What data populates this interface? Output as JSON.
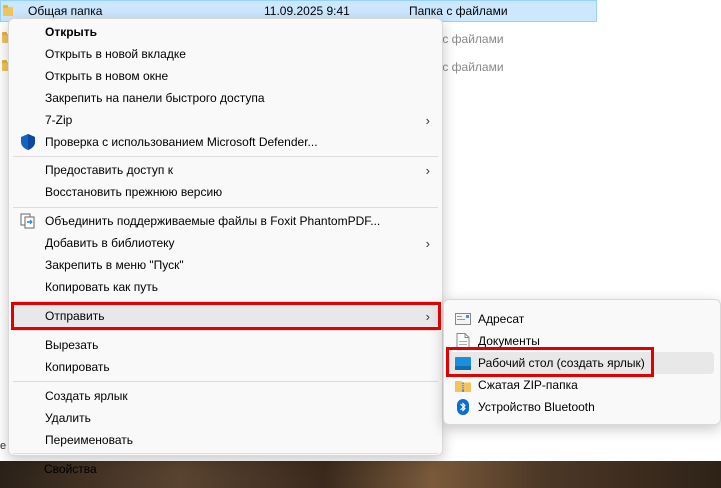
{
  "files": [
    {
      "name": "Общая папка",
      "date": "11.09.2025 9:41",
      "type": "Папка с файлами"
    },
    {
      "type": "Папка с файлами"
    },
    {
      "type": "Папка с файлами"
    }
  ],
  "bottom_fragment": "е",
  "menu": {
    "items": [
      {
        "label": "Открыть"
      },
      {
        "label": "Открыть в новой вкладке"
      },
      {
        "label": "Открыть в новом окне"
      },
      {
        "label": "Закрепить на панели быстрого доступа"
      },
      {
        "label": "7-Zip",
        "arrow": "›"
      },
      {
        "label": "Проверка с использованием Microsoft Defender..."
      },
      {
        "label": "Предоставить доступ к",
        "arrow": "›"
      },
      {
        "label": "Восстановить прежнюю версию"
      },
      {
        "label": "Объединить поддерживаемые файлы в Foxit PhantomPDF..."
      },
      {
        "label": "Добавить в библиотеку",
        "arrow": "›"
      },
      {
        "label": "Закрепить в меню \"Пуск\""
      },
      {
        "label": "Копировать как путь"
      },
      {
        "label": "Отправить",
        "arrow": "›"
      },
      {
        "label": "Вырезать"
      },
      {
        "label": "Копировать"
      },
      {
        "label": "Создать ярлык"
      },
      {
        "label": "Удалить"
      },
      {
        "label": "Переименовать"
      },
      {
        "label": "Свойства"
      }
    ]
  },
  "submenu": {
    "items": [
      {
        "label": "Адресат",
        "icon": "mail-recipient-icon"
      },
      {
        "label": "Документы",
        "icon": "documents-icon"
      },
      {
        "label": "Рабочий стол (создать ярлык)",
        "icon": "desktop-icon"
      },
      {
        "label": "Сжатая ZIP-папка",
        "icon": "zip-folder-icon"
      },
      {
        "label": "Устройство Bluetooth",
        "icon": "bluetooth-icon"
      }
    ]
  },
  "colors": {
    "highlight": "#e00000",
    "selection": "#cce8ff",
    "defender": "#1565c0",
    "bluetooth": "#0a6ed1"
  }
}
